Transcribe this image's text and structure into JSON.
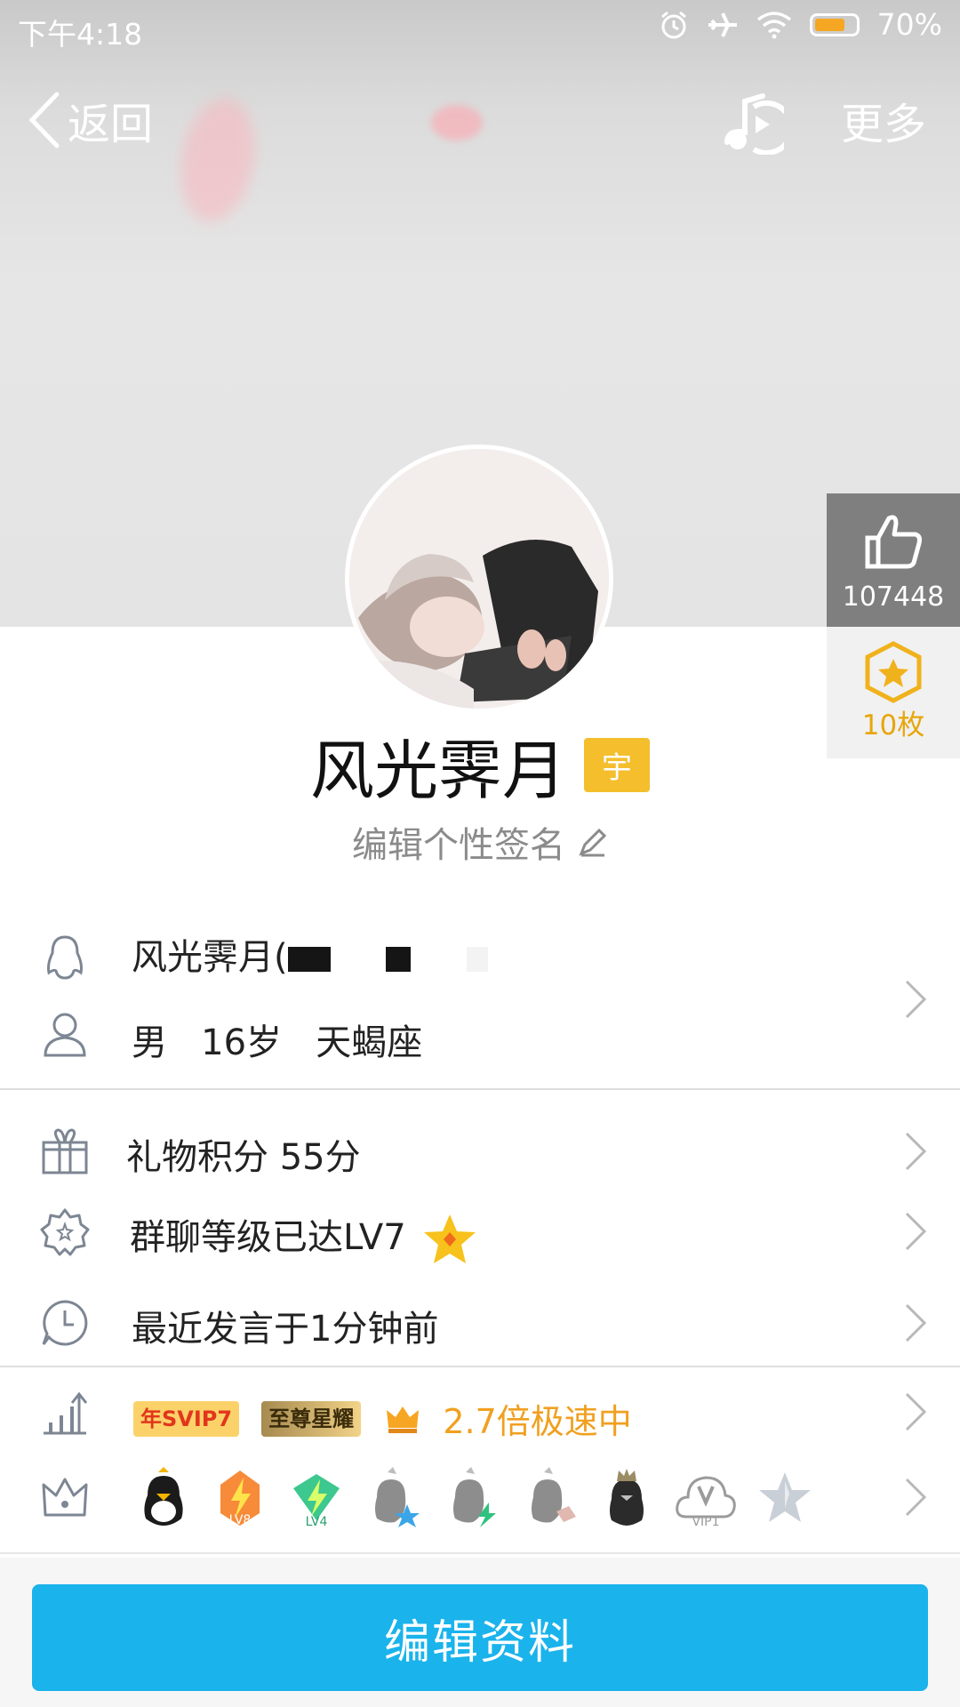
{
  "status": {
    "time": "下午4:18",
    "battery_pct": "70%"
  },
  "nav": {
    "back_label": "返回",
    "more_label": "更多"
  },
  "profile": {
    "nickname": "风光霁月",
    "badge": "宇",
    "signature_placeholder": "编辑个性签名"
  },
  "side": {
    "likes": "107448",
    "medals": "10枚"
  },
  "info": {
    "account": "风光霁月(",
    "gender": "男",
    "age": "16岁",
    "zodiac": "天蝎座",
    "gift_points": "礼物积分 55分",
    "group_level": "群聊等级已达LV7",
    "last_speak": "最近发言于1分钟前",
    "svip_badge": "年SVIP7",
    "star_badge": "至尊星耀",
    "speed_text": "2.7倍极速中",
    "lv8": "LV8",
    "lv4": "LV4",
    "vip1": "VIP1"
  },
  "actions": {
    "edit_profile": "编辑资料"
  },
  "colors": {
    "accent": "#1ab3ec",
    "gold": "#e7a60a",
    "speed": "#f0a020"
  }
}
